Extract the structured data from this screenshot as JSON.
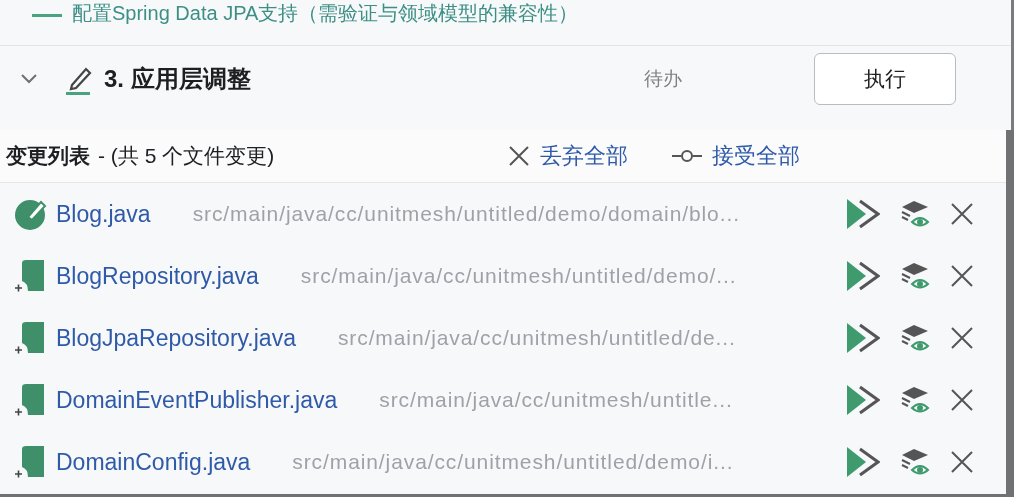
{
  "previous_step": {
    "text": "配置Spring Data JPA支持（需验证与领域模型的兼容性）"
  },
  "step": {
    "expanded": true,
    "title": "3. 应用层调整",
    "status": "待办",
    "button": "执行"
  },
  "changes": {
    "title": "变更列表",
    "summary": "- (共 5 个文件变更)",
    "discard_all": "丢弃全部",
    "accept_all": "接受全部",
    "files": [
      {
        "name": "Blog.java",
        "path": "src/main/java/cc/unitmesh/untitled/demo/domain/blo...",
        "kind": "modified"
      },
      {
        "name": "BlogRepository.java",
        "path": "src/main/java/cc/unitmesh/untitled/demo/...",
        "kind": "added"
      },
      {
        "name": "BlogJpaRepository.java",
        "path": "src/main/java/cc/unitmesh/untitled/de...",
        "kind": "added"
      },
      {
        "name": "DomainEventPublisher.java",
        "path": "src/main/java/cc/unitmesh/untitle...",
        "kind": "added"
      },
      {
        "name": "DomainConfig.java",
        "path": "src/main/java/cc/unitmesh/untitled/demo/i...",
        "kind": "added"
      }
    ]
  }
}
